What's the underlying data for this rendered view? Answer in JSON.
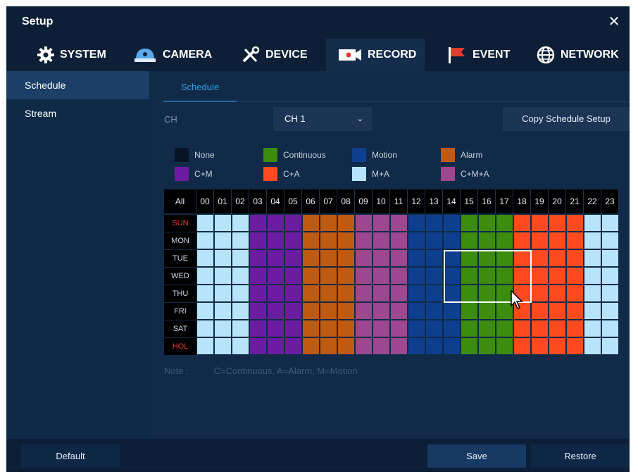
{
  "window": {
    "title": "Setup"
  },
  "tabs": [
    {
      "label": "SYSTEM",
      "icon": "gear-icon"
    },
    {
      "label": "CAMERA",
      "icon": "camera-icon"
    },
    {
      "label": "DEVICE",
      "icon": "tools-icon"
    },
    {
      "label": "RECORD",
      "icon": "record-icon",
      "active": true
    },
    {
      "label": "EVENT",
      "icon": "flag-icon"
    },
    {
      "label": "NETWORK",
      "icon": "globe-icon"
    }
  ],
  "sidebar": {
    "items": [
      {
        "label": "Schedule",
        "active": true
      },
      {
        "label": "Stream"
      }
    ]
  },
  "main": {
    "subtab": "Schedule",
    "ch_label": "CH",
    "ch_value": "CH 1",
    "copy_label": "Copy Schedule Setup",
    "note_label": "Note :",
    "note_text": "C=Continuous, A=Alarm, M=Motion"
  },
  "legend": [
    {
      "label": "None",
      "color": "#071426"
    },
    {
      "label": "Continuous",
      "color": "#3c8c0e"
    },
    {
      "label": "Motion",
      "color": "#0e3f8e"
    },
    {
      "label": "Alarm",
      "color": "#bf5a11"
    },
    {
      "label": "C+M",
      "color": "#6c1ca3"
    },
    {
      "label": "C+A",
      "color": "#ff4a1f"
    },
    {
      "label": "M+A",
      "color": "#b8e4fb"
    },
    {
      "label": "C+M+A",
      "color": "#9c4790"
    }
  ],
  "schedule": {
    "all_label": "All",
    "hours": [
      "00",
      "01",
      "02",
      "03",
      "04",
      "05",
      "06",
      "07",
      "08",
      "09",
      "10",
      "11",
      "12",
      "13",
      "14",
      "15",
      "16",
      "17",
      "18",
      "19",
      "20",
      "21",
      "22",
      "23"
    ],
    "days": [
      {
        "label": "SUN",
        "holiday": true
      },
      {
        "label": "MON"
      },
      {
        "label": "TUE"
      },
      {
        "label": "WED"
      },
      {
        "label": "THU"
      },
      {
        "label": "FRI"
      },
      {
        "label": "SAT"
      },
      {
        "label": "HOL",
        "holiday": true
      }
    ],
    "hour_modes": [
      "M+A",
      "M+A",
      "M+A",
      "C+M",
      "C+M",
      "C+M",
      "Alarm",
      "Alarm",
      "Alarm",
      "C+M+A",
      "C+M+A",
      "C+M+A",
      "Motion",
      "Motion",
      "Motion",
      "Continuous",
      "Continuous",
      "Continuous",
      "C+A",
      "C+A",
      "C+A",
      "C+A",
      "M+A",
      "M+A"
    ]
  },
  "buttons": {
    "default": "Default",
    "save": "Save",
    "restore": "Restore"
  }
}
